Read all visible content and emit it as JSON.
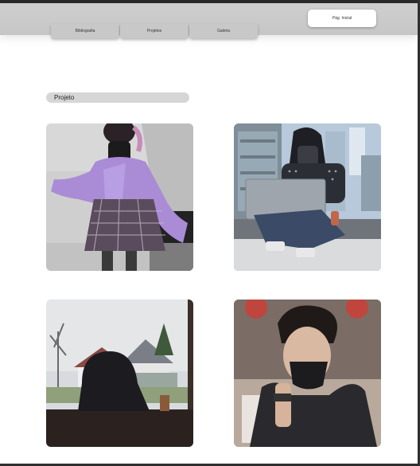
{
  "header": {
    "home_label": "Pág. Inicial",
    "tabs": [
      {
        "label": "Bibliografia"
      },
      {
        "label": "Projetos"
      },
      {
        "label": "Galeria"
      }
    ]
  },
  "section": {
    "title": "Projeto"
  },
  "gallery": [
    {
      "subject": "girl in purple cardigan and plaid skirt"
    },
    {
      "subject": "masked hacker with laptop on rooftop"
    },
    {
      "subject": "hooded figure on couch by window"
    },
    {
      "subject": "man in black mask and leather jacket"
    }
  ]
}
